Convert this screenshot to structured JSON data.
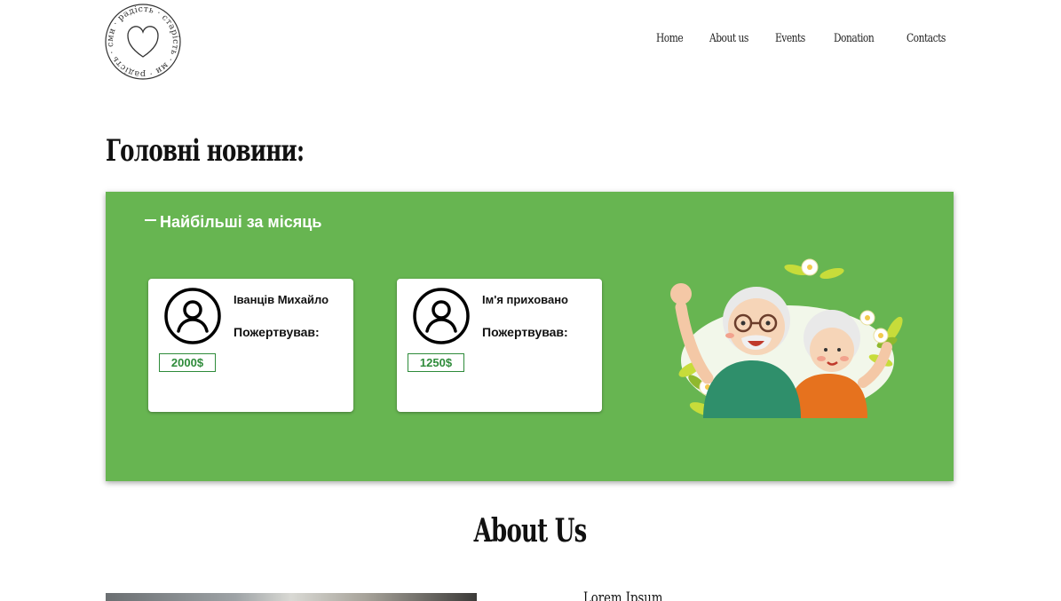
{
  "header": {
    "logo": {
      "text": "ми · радість · старість · ми · радість · старість ·",
      "icon": "heart-icon"
    },
    "nav": {
      "home": "Home",
      "about": "About us",
      "events": "Events",
      "donation": "Donation",
      "contacts": "Contacts"
    }
  },
  "main": {
    "title": "Головні новини:",
    "panel": {
      "heading": "Найбільші за місяць",
      "background_color": "#67b551",
      "cards": [
        {
          "name": "Іванців Михайло",
          "label": "Пожертвував:",
          "amount": "2000$",
          "icon": "user-icon"
        },
        {
          "name": "Ім'я приховано",
          "label": "Пожертвував:",
          "amount": "1250$",
          "icon": "user-icon"
        }
      ],
      "illustration": "elderly-couple-waving-illustration"
    }
  },
  "about": {
    "title": "About Us",
    "subtitle": "Lorem Ipsum"
  },
  "colors": {
    "accent_green": "#67b551",
    "amount_green": "#2e8b3a"
  }
}
